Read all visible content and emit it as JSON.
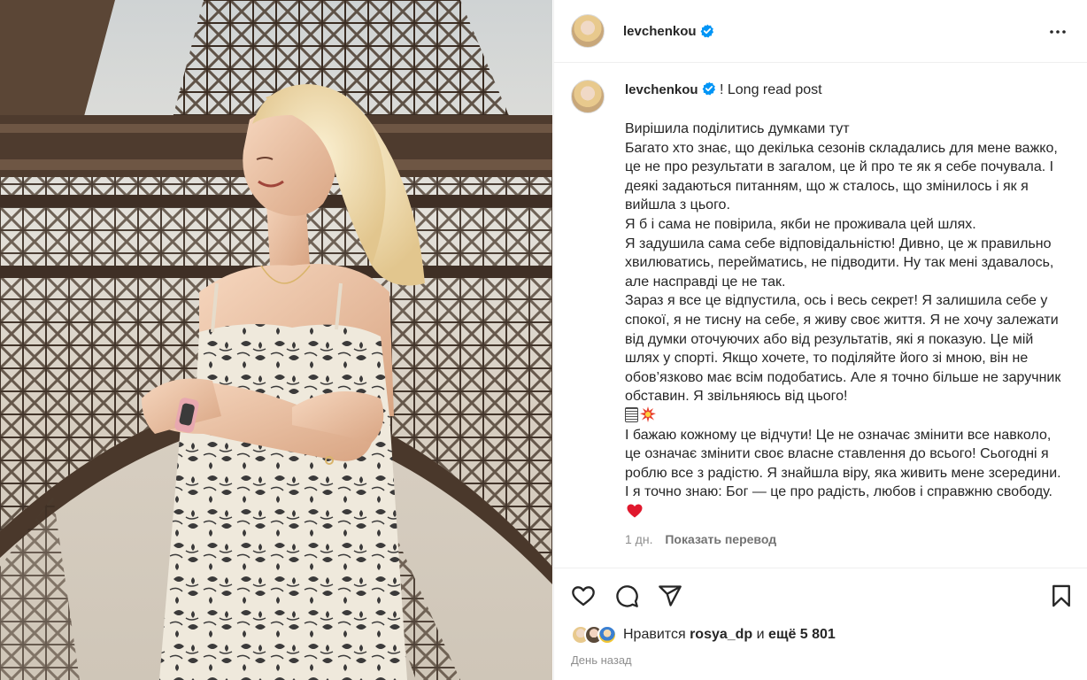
{
  "post": {
    "username": "levchenkou",
    "caption_title": "! Long read post",
    "caption_lines": [
      "Вирішила поділитись думками тут",
      "Багато хто знає, що декілька сезонів складались для мене важко, це не про результати в загалом, це й про те як я себе почувала. І деякі задаються питанням, що ж сталось, що змінилось і як я вийшла з цього.",
      "Я б і сама не повірила, якби не проживала цей шлях.",
      "Я задушила сама себе відповідальністю! Дивно, це ж правильно хвилюватись, перейматись, не підводити. Ну так мені здавалось, але насправді це не так.",
      "Зараз я все це відпустила, ось і весь секрет! Я залишила себе у спокої, я не тисну на себе, я живу своє життя. Я не хочу залежати від думки оточуючих або від результатів, які я показую. Це мій шлях у спорті. Якщо хочете, то поділяйте його зі мною, він не обов’язково має всім подобатись. Але я точно більше не заручник обставин. Я звільняюсь від цього!",
      "І бажаю кожному це відчути! Це не означає змінити все навколо, це означає змінити своє власне ставлення до всього! Сьогодні я роблю все з радістю. Я знайшла віру, яка живить мене зсередини. І я точно знаю: Бог — це про радість, любов і справжню свободу."
    ],
    "time_ago": "1 дн.",
    "translate_label": "Показать перевод",
    "likes_prefix": "Нравится",
    "likes_user": "rosya_dp",
    "likes_and": "и",
    "likes_more": "ещё 5 801",
    "posted": "День назад"
  },
  "icons": {
    "verified": "verified-badge-icon",
    "more": "more-options-icon",
    "like": "heart-outline-icon",
    "comment": "comment-bubble-icon",
    "share": "paper-plane-icon",
    "save": "bookmark-icon",
    "caption_end": "red-heart-emoji",
    "caption_emojis": [
      "dice-emoji",
      "collision-emoji"
    ]
  },
  "colors": {
    "verified_blue": "#0095f6",
    "heart_red": "#e0182d",
    "secondary_text": "#8e8e8e"
  }
}
